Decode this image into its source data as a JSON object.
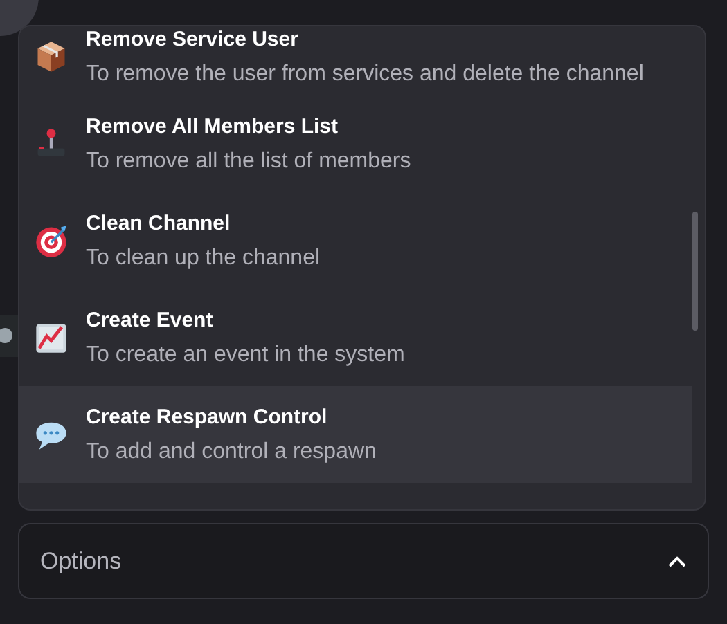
{
  "menu": {
    "items": [
      {
        "title": "Remove Service User",
        "description": "To remove the user from services and delete the channel",
        "selected": false
      },
      {
        "title": "Remove All Members List",
        "description": "To remove all the list of members",
        "selected": false
      },
      {
        "title": "Clean Channel",
        "description": "To clean up the channel",
        "selected": false
      },
      {
        "title": "Create Event",
        "description": "To create an event in the system",
        "selected": false
      },
      {
        "title": "Create Respawn Control",
        "description": "To add and control a respawn",
        "selected": true
      }
    ]
  },
  "options": {
    "label": "Options",
    "expanded": true
  }
}
